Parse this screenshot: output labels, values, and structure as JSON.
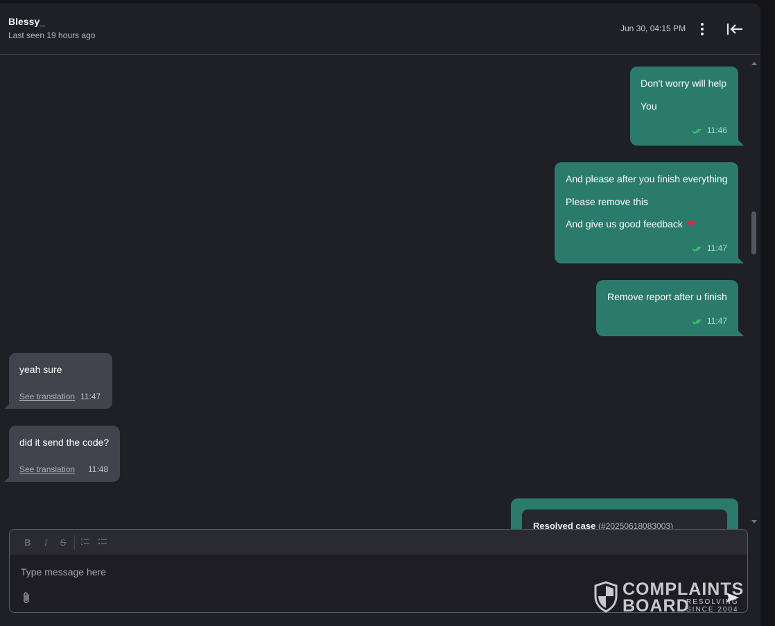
{
  "header": {
    "name": "Blessy_",
    "last_seen": "Last seen 19 hours ago",
    "date": "Jun 30, 04:15 PM",
    "menu_icon": "kebab-vertical-icon",
    "back_icon": "arrow-left-to-bar-icon"
  },
  "messages": {
    "m1": {
      "line1": "Don't worry will help",
      "line2": "You",
      "time": "11:46"
    },
    "m2": {
      "line1": "And please after you finish everything",
      "line2": "Please remove this",
      "line3": "And give us good feedback",
      "emoji": "❤",
      "time": "11:47"
    },
    "m3": {
      "line1": "Remove report after u finish",
      "time": "11:47"
    },
    "m4": {
      "text": "yeah sure",
      "translate": "See translation",
      "time": "11:47"
    },
    "m5": {
      "text": "did it send the code?",
      "translate": "See translation",
      "time": "11:48"
    },
    "m6": {
      "title": "Resolved case",
      "case_id": "(#20250618083003)"
    }
  },
  "composer": {
    "placeholder": "Type message here",
    "toolbar": {
      "bold": "B",
      "italic": "I",
      "strike": "S"
    }
  },
  "watermark": {
    "line1": "COMPLAINTS",
    "line2": "BOARD",
    "tagline1": "RESOLVING",
    "tagline2": "SINCE 2004"
  },
  "colors": {
    "outgoing_bubble": "#2a7b6c",
    "incoming_bubble": "#43434e",
    "background": "#1f1f26",
    "read_check": "#3ed26a"
  }
}
